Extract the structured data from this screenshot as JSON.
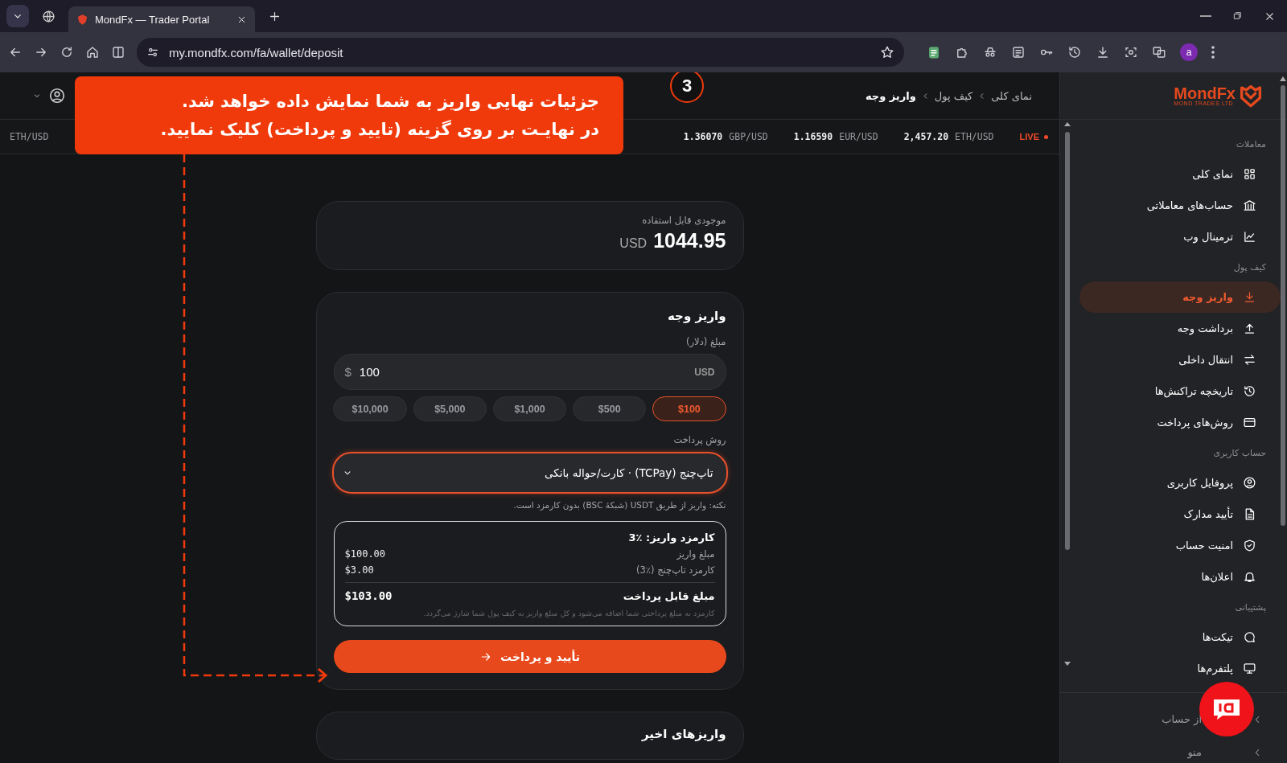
{
  "browser": {
    "tabs": [
      {
        "title": "MondFx — Trader Portal",
        "selected": true
      }
    ],
    "url": "my.mondfx.com/fa/wallet/deposit",
    "avatar": "a"
  },
  "header": {
    "breadcrumbs": [
      {
        "label": "نمای کلی",
        "current": false
      },
      {
        "label": "کیف پول",
        "current": false
      },
      {
        "label": "واریز وجه",
        "current": true
      }
    ]
  },
  "ticker": {
    "left": [
      {
        "pair": "ETH/USD"
      }
    ],
    "right": [
      {
        "value": "2,457.20",
        "pair": "ETH/USD"
      },
      {
        "value": "1.16590",
        "pair": "EUR/USD"
      },
      {
        "value": "1.36070",
        "pair": "GBP/USD"
      }
    ],
    "live": "LIVE"
  },
  "annotation": {
    "number": "3",
    "lines": [
      "جزئیات نهایی واریز به شما نمایش داده خواهد شد.",
      "در نهایـت بر روی گزینه (تایید و پرداخت) کلیک نمایید."
    ]
  },
  "balance": {
    "label": "موجودی قابل استفاده",
    "currency": "USD",
    "amount": "1044.95"
  },
  "deposit": {
    "title": "واریز وجه",
    "amount_label": "مبلغ (دلار)",
    "amount_field": {
      "prefix": "$",
      "value": "100",
      "suffix": "USD"
    },
    "presets": [
      {
        "label": "$100",
        "selected": true
      },
      {
        "label": "$500",
        "selected": false
      },
      {
        "label": "$1,000",
        "selected": false
      },
      {
        "label": "$5,000",
        "selected": false
      },
      {
        "label": "$10,000",
        "selected": false
      }
    ],
    "method_label": "روش پرداخت",
    "method": {
      "value": "تاپ‌چنج (TCPay) · کارت/حواله بانکی"
    },
    "note": "نکته: واریز از طریق USDT (شبکهٔ BSC) بدون کارمزد است.",
    "fee": {
      "title": "کارمزد واریز: ٪3",
      "rows": [
        {
          "label": "مبلغ واریز",
          "value": "$100.00"
        },
        {
          "label": "کارمزد تاپ‌چنج (٪3)",
          "value": "$3.00"
        }
      ],
      "total": {
        "label": "مبلغ قابل پرداخت",
        "value": "$103.00"
      },
      "footnote": "کارمزد به مبلغ پرداختی شما اضافه می‌شود و کل مبلغ واریز به کیف پول شما شارژ می‌گردد."
    },
    "submit": "تأیید و پرداخت"
  },
  "recent": {
    "title": "واریزهای اخیر"
  },
  "sidebar": {
    "logo": {
      "name": "MondFx",
      "tagline": "MOND TRADES LTD"
    },
    "sections": [
      {
        "title": "معاملات",
        "items": [
          {
            "label": "نمای کلی",
            "selected": false
          },
          {
            "label": "حساب‌های معاملاتی",
            "selected": false
          },
          {
            "label": "ترمینال وب",
            "selected": false
          }
        ]
      },
      {
        "title": "کیف پول",
        "items": [
          {
            "label": "واریز وجه",
            "selected": true
          },
          {
            "label": "برداشت وجه",
            "selected": false
          },
          {
            "label": "انتقال داخلی",
            "selected": false
          },
          {
            "label": "تاریخچه تراکنش‌ها",
            "selected": false
          },
          {
            "label": "روش‌های پرداخت",
            "selected": false
          }
        ]
      },
      {
        "title": "حساب کاربری",
        "items": [
          {
            "label": "پروفایل کاربری",
            "selected": false
          },
          {
            "label": "تأیید مدارک",
            "selected": false
          },
          {
            "label": "امنیت حساب",
            "selected": false
          },
          {
            "label": "اعلان‌ها",
            "selected": false
          }
        ]
      },
      {
        "title": "پشتیبانی",
        "items": [
          {
            "label": "تیکت‌ها",
            "selected": false
          },
          {
            "label": "پلتفرم‌ها",
            "selected": false
          }
        ]
      }
    ],
    "footer": [
      {
        "label": "از حساب"
      },
      {
        "label": "منو"
      }
    ]
  }
}
